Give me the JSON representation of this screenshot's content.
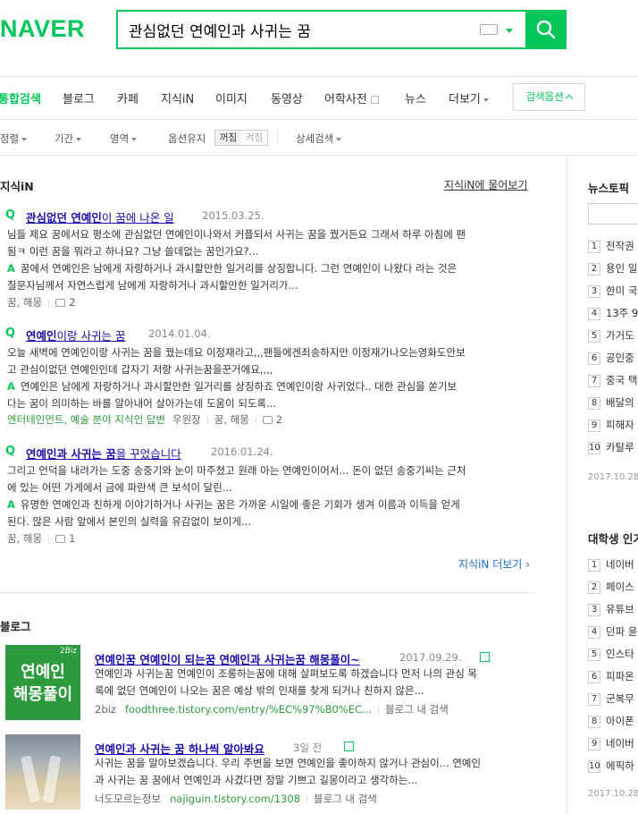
{
  "header": {
    "logo": "NAVER",
    "query": "관심없던 연예인과 사귀는 꿈"
  },
  "tabs": [
    "통합검색",
    "블로그",
    "카페",
    "지식iN",
    "이미지",
    "동영상",
    "어학사전",
    "뉴스",
    "더보기"
  ],
  "search_options_label": "검색옵션",
  "filters": {
    "sort": "정렬",
    "period": "기간",
    "area": "영역",
    "keep_label": "옵션유지",
    "keep_off": "꺼짐",
    "keep_on": "켜짐",
    "detail": "상세검색"
  },
  "kin": {
    "title": "지식iN",
    "ask_link": "지식iN에 물어보기",
    "more": "지식iN 더보기",
    "items": [
      {
        "title_pre": "관심없던 연예인",
        "title_post": "이 꿈에 나온 일",
        "date": "2015.03.25.",
        "q1": "님들 제요 꿈에서요 평소에 관심없던 연예인이나와서 커플되서 사귀는 꿈을 꿨거든요 그래서 하루 아침에 팬",
        "q2": "됨ㅋ 이런 꿈을 뭐라고 하나요? 그냥 쓸데없는 꿈인가요?...",
        "a1": "꿈에서 연예인은 남에게 자랑하거나 과시할만한 일거리를 상징합니다. 그런 연예인이 나왔다 라는 것은",
        "a2": "질문자님께서 자연스럽게 남에게 자랑하거나 과시할만한 일거리가...",
        "tags": "꿈, 해몽",
        "comments": "2"
      },
      {
        "title_pre": "연예인",
        "title_post": "이랑 사귀는 꿈",
        "date": "2014.01.04.",
        "q1": "오늘 새벽에 연예인이랑 사귀는 꿈을 꿨는데요 이정재라고,,,팬들에겐죄송하지만 이정재가나오는영화도안보",
        "q2": "고 관심이없던 연예인인데 갑자기 저랑 사귀는꿈을꾼거에요,,,,",
        "a1": "연예인은 남에게 자랑하거나 과시할만한 일거리를 상징하죠 연예인이랑 사귀었다.. 대한 관심을 쏟기보",
        "a2": "다는 꿈이 의미하는 바를 알아내어 살아가는데 도움이 되도록...",
        "category": "엔터테인먼트, 예술 분야 지식인 답변",
        "answerer": "우원장",
        "tags": "꿈, 해몽",
        "comments": "2"
      },
      {
        "title_pre": "연예인과 사귀는 꿈",
        "title_post": "을 꾸었습니다",
        "date": "2016.01.24.",
        "q1": "그리고 언덕을 내려가는 도중 송중기와 눈이 마주쳤고 원래 아는 연예인이어서... 돈이 없던 송중기씨는 근처",
        "q2": "에 있는 어떤 가게에서 금에 파란색 큰 보석이 달린...",
        "a1": "유명한 연예인과 친하게 이야기하거나 사귀는 꿈은 가까운 시일에 좋은 기회가 생겨 이름과 이득을 얻게",
        "a2": "된다. 많은 사람 앞에서 본인의 실력을 유감없이 보이게...",
        "tags": "꿈, 해몽",
        "comments": "1"
      }
    ]
  },
  "blog": {
    "title": "블로그",
    "items": [
      {
        "thumb_badge": "2Biz",
        "thumb_line1": "연예인",
        "thumb_line2": "해몽풀이",
        "title": "연예인꿈 연예인이 되는꿈 연예인과 사귀는꿈 해몽풀이~",
        "date": "2017.09.29.",
        "body1": "연예인과 사귀는꿈 연예인이 조롱하는꿈에 대해 살펴보도록 하겠습니다 먼저 나의 관심 목",
        "body2": "록에 없던 연예인이 나오는 꿈은 예상 밖의 인재를 찾게 되거나 친하지 않은...",
        "source": "2biz",
        "url": "foodthree.tistory.com/entry/%EC%97%B0%EC...",
        "inner": "블로그 내 검색"
      },
      {
        "title": "연예인과 사귀는 꿈 하나씩 알아봐요",
        "date": "3일 전",
        "body1": "사귀는 꿈을 알아보겠습니다. 우리 주변을 보면 연예인을 좋아하지 않거나 관심이... 연예인",
        "body2": "과 사귀는 꿈 꿈에서 연예인과 사겼다면 정말 기쁘고 길몽이라고 생각하는...",
        "source": "너도모르는정보",
        "url": "najiguin.tistory.com/1308",
        "inner": "블로그 내 검색"
      }
    ]
  },
  "sidebar": {
    "news_title": "뉴스토픽",
    "news": [
      "전작권",
      "용인 일",
      "한미 국",
      "13주 9",
      "가거도",
      "공인중",
      "중국 택",
      "배달의",
      "피해자",
      "카탈루"
    ],
    "news_date": "2017.10.28.",
    "uni_title": "대학생 인기",
    "uni": [
      "네이버",
      "페이스",
      "유튜브",
      "던파 윤",
      "인스타",
      "피파온",
      "군복무",
      "아이폰",
      "네이버",
      "에픽하"
    ],
    "uni_date": "2017.10.28."
  },
  "colors": {
    "brand": "#03c75a",
    "link": "#1a0dab"
  }
}
